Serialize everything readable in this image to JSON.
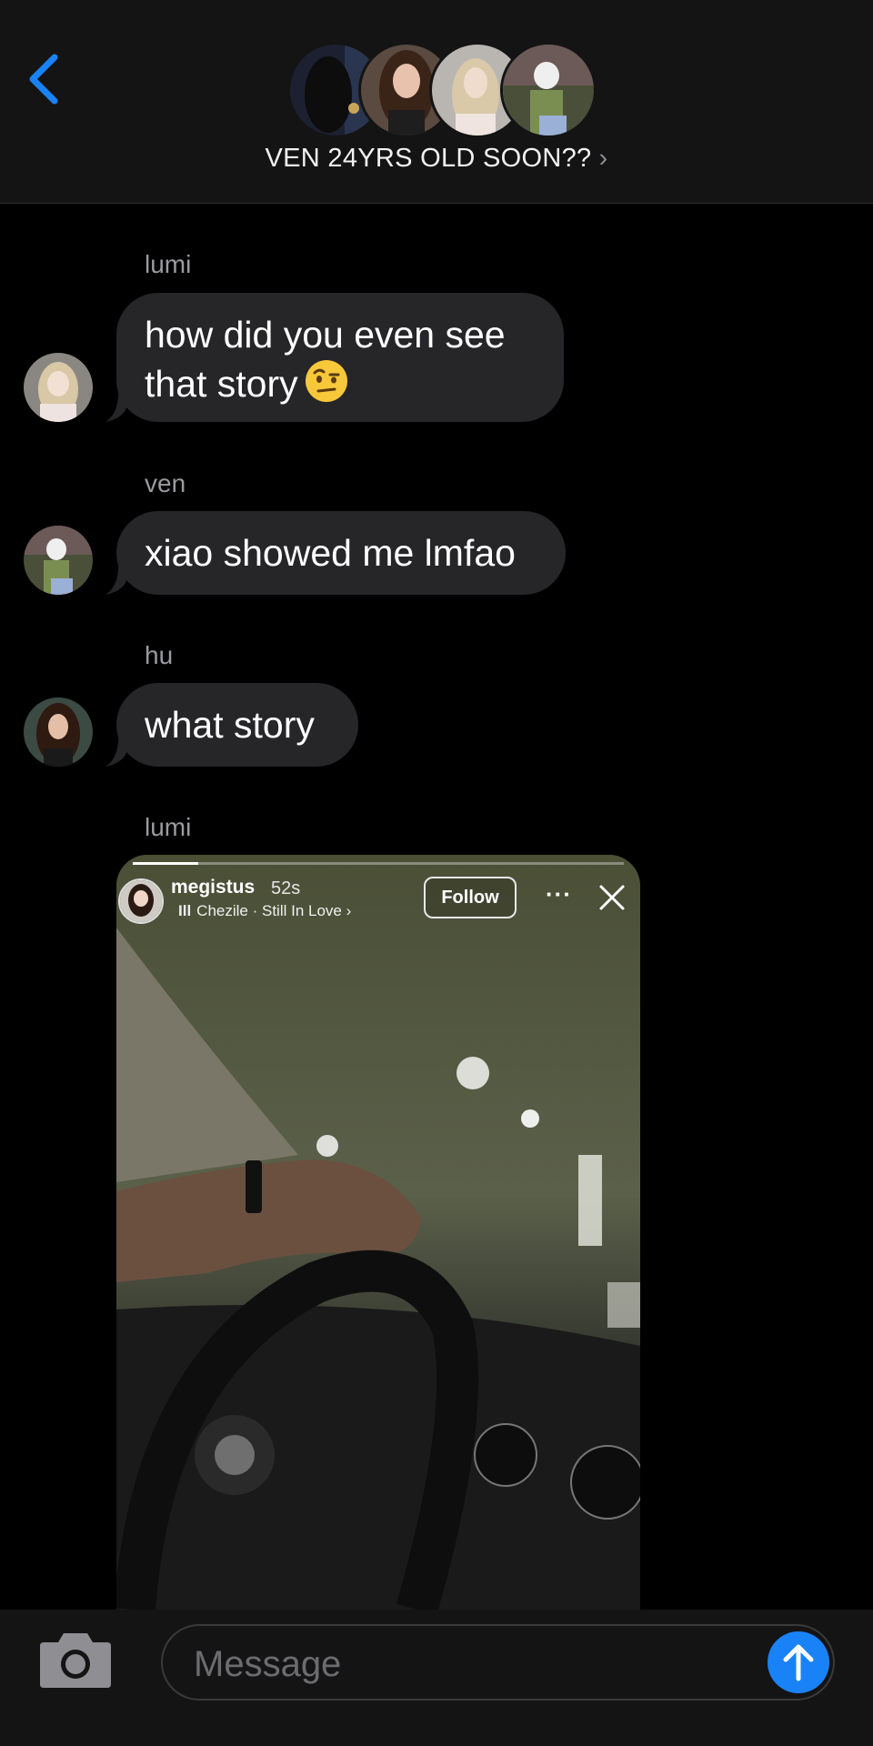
{
  "header": {
    "group_title": "VEN 24YRS OLD SOON??",
    "title_chevron": "›",
    "back_icon": "chevron-left-icon",
    "accent": "#1a82f7"
  },
  "messages": [
    {
      "sender": "lumi",
      "text_line1": "how did you even see",
      "text_line2": "that story",
      "emoji": "raised-eyebrow-face"
    },
    {
      "sender": "ven",
      "text": "xiao showed me lmfao"
    },
    {
      "sender": "hu",
      "text": "what story"
    },
    {
      "sender": "lumi",
      "type": "shared-story"
    }
  ],
  "story": {
    "username": "megistus",
    "time": "52s",
    "music": "Chezile · Still In Love ›",
    "follow_label": "Follow",
    "more_label": "···"
  },
  "composer": {
    "placeholder": "Message",
    "camera_icon": "camera-icon",
    "send_icon": "arrow-up-icon"
  },
  "colors": {
    "bubble": "#262628",
    "header_bg": "#141414",
    "send": "#1a82f7"
  }
}
